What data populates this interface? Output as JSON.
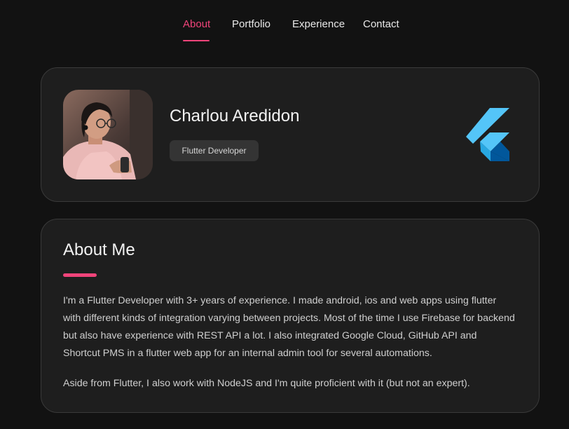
{
  "nav": {
    "items": [
      {
        "label": "About",
        "active": true
      },
      {
        "label": "Portfolio",
        "active": false
      },
      {
        "label": "Experience",
        "active": false
      },
      {
        "label": "Contact",
        "active": false
      }
    ]
  },
  "profile": {
    "name": "Charlou Aredidon",
    "role": "Flutter Developer",
    "logo_icon": "flutter-logo-icon"
  },
  "about": {
    "title": "About Me",
    "paragraphs": [
      "I'm a Flutter Developer with 3+ years of experience. I made android, ios and web apps using flutter with different kinds of integration varying between projects. Most of the time I use Firebase for backend but also have experience with REST API a lot. I also integrated Google Cloud, GitHub API and Shortcut PMS in a flutter web app for an internal admin tool for several automations.",
      "Aside from Flutter, I also work with NodeJS and I'm quite proficient with it (but not an expert)."
    ]
  },
  "colors": {
    "accent": "#f0447a",
    "background": "#121212",
    "card": "#1e1e1e",
    "flutter_light": "#54c5f8",
    "flutter_dark": "#01579b"
  }
}
